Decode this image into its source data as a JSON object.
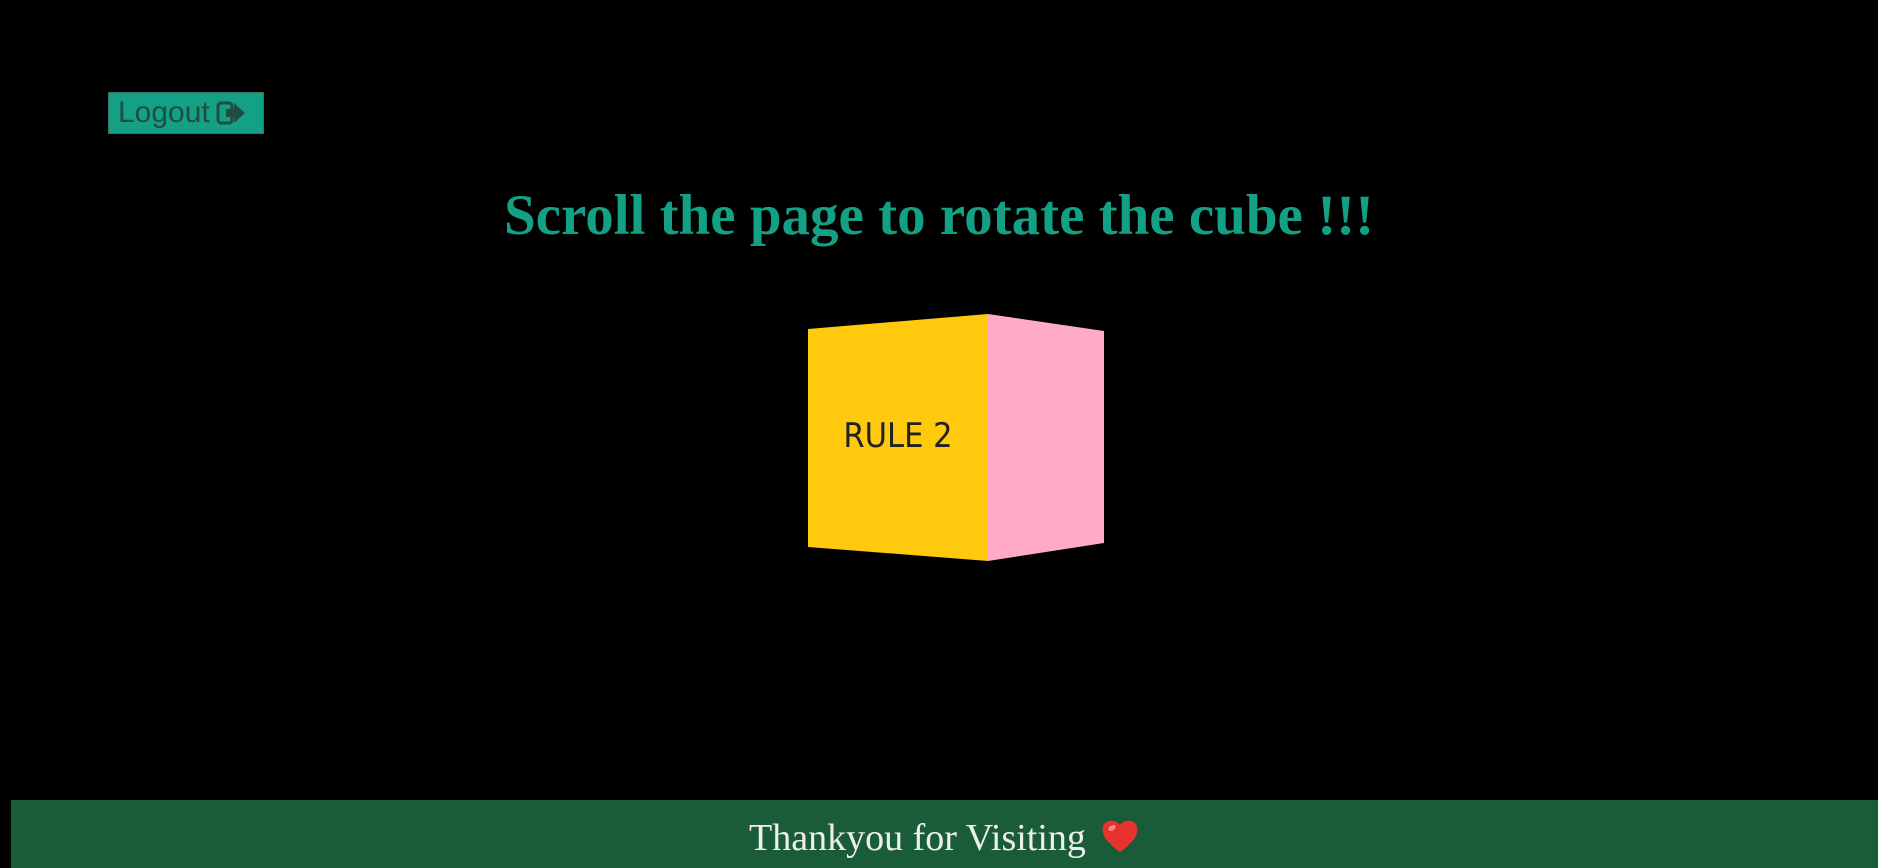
{
  "header": {
    "logout_label": "Logout",
    "logout_icon": "sign-out-icon"
  },
  "main": {
    "headline": "Scroll the page to rotate the cube !!!",
    "cube_front_label": "RULE 2",
    "cube_front_color": "#ffc90e",
    "cube_side_color": "#ffabc8"
  },
  "footer": {
    "text": "Thankyou for Visiting",
    "icon": "heart-icon"
  },
  "colors": {
    "accent": "#14a085",
    "background": "#000000",
    "footer_bg": "#1a5c38",
    "heart": "#e8322e"
  }
}
